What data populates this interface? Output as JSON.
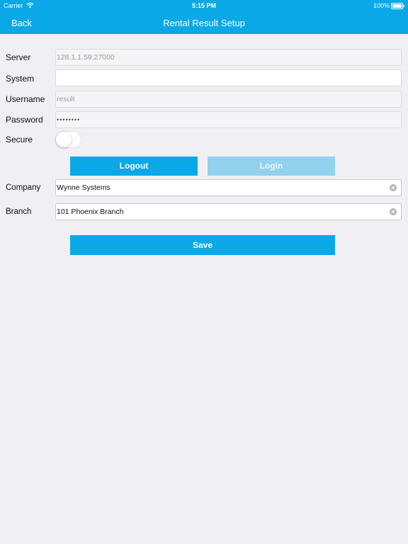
{
  "status_bar": {
    "carrier": "Carrier",
    "time": "5:15 PM",
    "battery": "100%"
  },
  "nav": {
    "back_label": "Back",
    "title": "Rental Result Setup"
  },
  "form": {
    "server": {
      "label": "Server",
      "value": "128.1.1.59:27000"
    },
    "system": {
      "label": "System",
      "value": ""
    },
    "username": {
      "label": "Username",
      "value": "result"
    },
    "password": {
      "label": "Password",
      "value": "••••••••"
    },
    "secure": {
      "label": "Secure",
      "on": false
    },
    "company": {
      "label": "Company",
      "value": "Wynne Systems"
    },
    "branch": {
      "label": "Branch",
      "value": "101 Phoenix Branch"
    }
  },
  "buttons": {
    "logout": "Logout",
    "login": "Login",
    "save": "Save"
  },
  "colors": {
    "accent": "#0aa8e6",
    "accent_disabled": "#93d2ee",
    "background": "#efeff4"
  },
  "icons": {
    "wifi": "wifi-icon",
    "battery": "battery-icon",
    "clear": "clear-icon"
  }
}
